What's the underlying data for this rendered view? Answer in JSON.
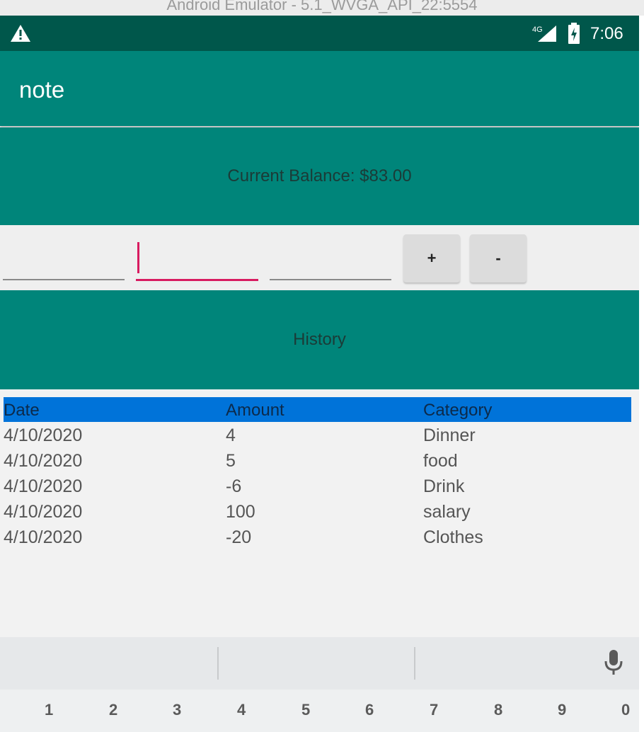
{
  "window": {
    "title": "Android Emulator - 5.1_WVGA_API_22:5554"
  },
  "status_bar": {
    "network": "4G",
    "time": "7:06",
    "warning_icon": "warning-triangle-icon",
    "signal_icon": "signal-icon",
    "battery_icon": "battery-charging-icon"
  },
  "app_bar": {
    "title": "note"
  },
  "balance": {
    "text": "Current Balance: $83.00"
  },
  "inputs": [
    {
      "name": "date-input",
      "value": "",
      "placeholder": ""
    },
    {
      "name": "amount-input",
      "value": "",
      "placeholder": "",
      "focused": true
    },
    {
      "name": "category-input",
      "value": "",
      "placeholder": ""
    }
  ],
  "buttons": {
    "add_label": "+",
    "subtract_label": "-"
  },
  "history": {
    "title": "History"
  },
  "table": {
    "headers": {
      "date": "Date",
      "amount": "Amount",
      "category": "Category"
    },
    "rows": [
      {
        "date": "4/10/2020",
        "amount": "4",
        "category": "Dinner"
      },
      {
        "date": "4/10/2020",
        "amount": "5",
        "category": "food"
      },
      {
        "date": "4/10/2020",
        "amount": "-6",
        "category": "Drink"
      },
      {
        "date": "4/10/2020",
        "amount": "100",
        "category": "salary"
      },
      {
        "date": "4/10/2020",
        "amount": "-20",
        "category": "Clothes"
      }
    ]
  },
  "keyboard": {
    "numbers": [
      "1",
      "2",
      "3",
      "4",
      "5",
      "6",
      "7",
      "8",
      "9",
      "0"
    ],
    "mic_icon": "microphone-icon"
  },
  "colors": {
    "primary": "#00857a",
    "primary_dark": "#00574b",
    "accent": "#d81b60",
    "header_blue": "#0073d9"
  }
}
